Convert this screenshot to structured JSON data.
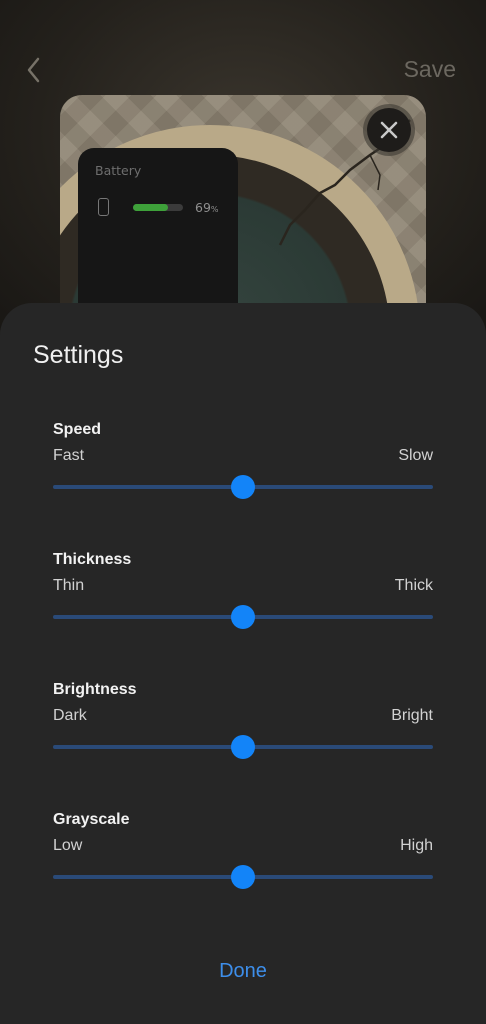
{
  "header": {
    "back_icon": "chevron-left-icon",
    "save_label": "Save"
  },
  "preview": {
    "close_icon": "close-icon",
    "battery_widget": {
      "title": "Battery",
      "level_percent": 69,
      "level_number": "69",
      "level_unit": "%",
      "bar_color": "#3ea13a"
    }
  },
  "settings": {
    "title": "Settings",
    "accent_color": "#1384f8",
    "items": [
      {
        "label": "Speed",
        "min_label": "Fast",
        "max_label": "Slow",
        "value": 0.5
      },
      {
        "label": "Thickness",
        "min_label": "Thin",
        "max_label": "Thick",
        "value": 0.5
      },
      {
        "label": "Brightness",
        "min_label": "Dark",
        "max_label": "Bright",
        "value": 0.5
      },
      {
        "label": "Grayscale",
        "min_label": "Low",
        "max_label": "High",
        "value": 0.5
      }
    ],
    "done_label": "Done"
  }
}
